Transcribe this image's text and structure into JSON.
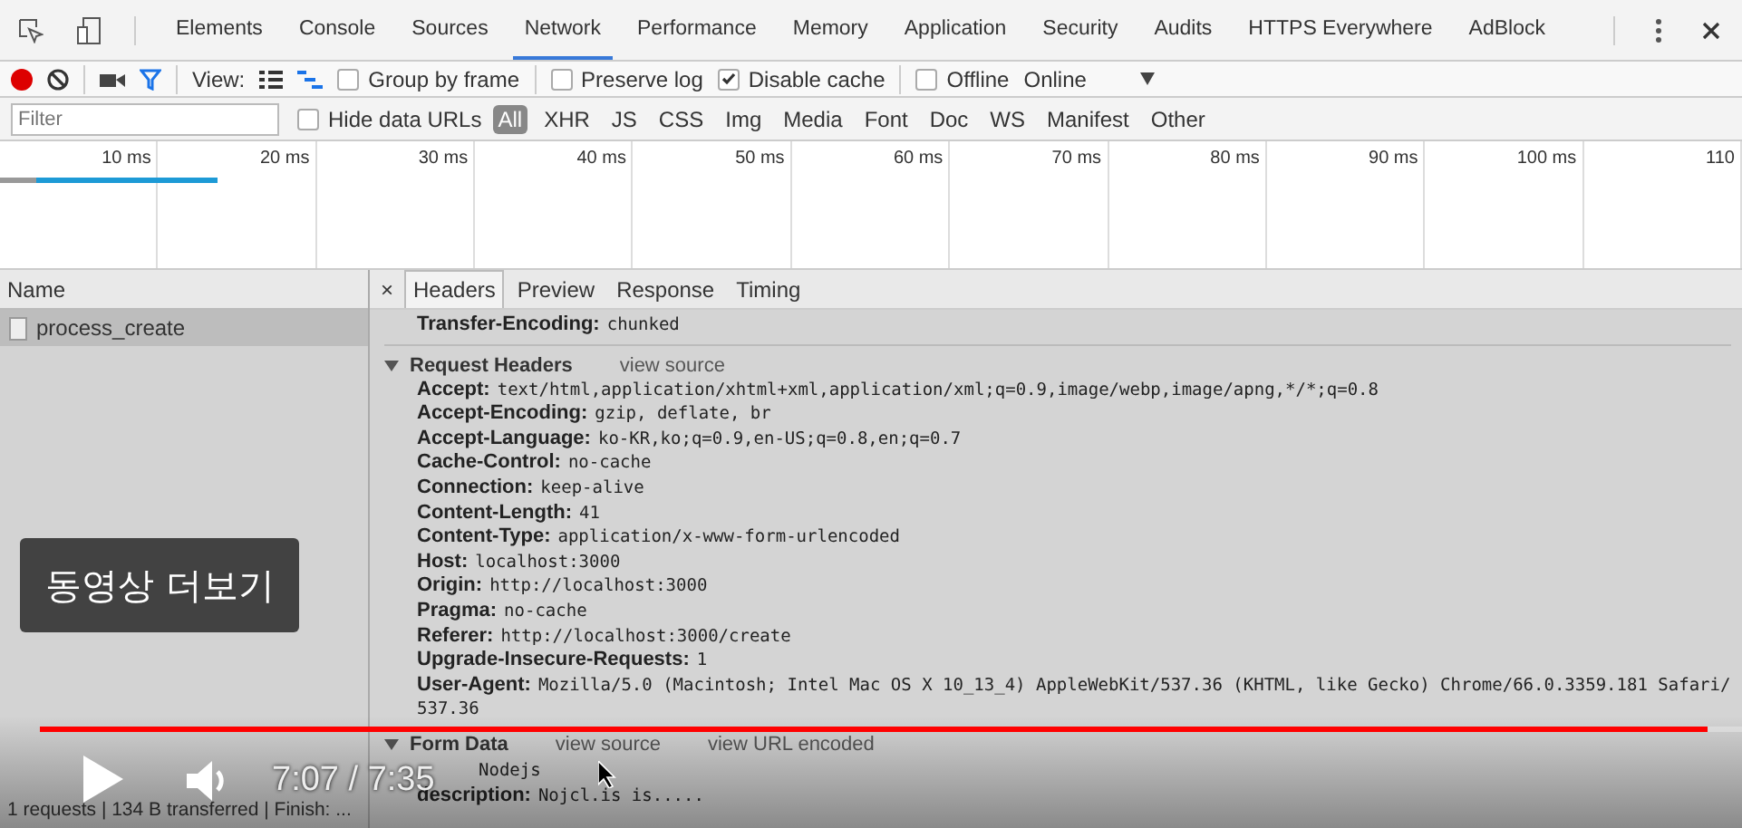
{
  "panel_tabs": [
    {
      "label": "Elements",
      "selected": false
    },
    {
      "label": "Console",
      "selected": false
    },
    {
      "label": "Sources",
      "selected": false
    },
    {
      "label": "Network",
      "selected": true
    },
    {
      "label": "Performance",
      "selected": false
    },
    {
      "label": "Memory",
      "selected": false
    },
    {
      "label": "Application",
      "selected": false
    },
    {
      "label": "Security",
      "selected": false
    },
    {
      "label": "Audits",
      "selected": false
    },
    {
      "label": "HTTPS Everywhere",
      "selected": false
    },
    {
      "label": "AdBlock",
      "selected": false
    }
  ],
  "toolbar": {
    "view_label": "View:",
    "options": [
      {
        "label": "Group by frame",
        "checked": false
      },
      {
        "label": "Preserve log",
        "checked": false
      },
      {
        "label": "Disable cache",
        "checked": true
      },
      {
        "label": "Offline",
        "checked": false
      }
    ],
    "throttling": "Online"
  },
  "filter": {
    "placeholder": "Filter",
    "hide_data_urls": {
      "label": "Hide data URLs",
      "checked": false
    },
    "types": [
      {
        "label": "All",
        "selected": true
      },
      {
        "label": "XHR",
        "selected": false
      },
      {
        "label": "JS",
        "selected": false
      },
      {
        "label": "CSS",
        "selected": false
      },
      {
        "label": "Img",
        "selected": false
      },
      {
        "label": "Media",
        "selected": false
      },
      {
        "label": "Font",
        "selected": false
      },
      {
        "label": "Doc",
        "selected": false
      },
      {
        "label": "WS",
        "selected": false
      },
      {
        "label": "Manifest",
        "selected": false
      },
      {
        "label": "Other",
        "selected": false
      }
    ]
  },
  "timeline": {
    "ticks": [
      "10 ms",
      "20 ms",
      "30 ms",
      "40 ms",
      "50 ms",
      "60 ms",
      "70 ms",
      "80 ms",
      "90 ms",
      "100 ms",
      "110"
    ]
  },
  "requests": {
    "column": "Name",
    "rows": [
      {
        "name": "process_create",
        "selected": true
      }
    ]
  },
  "details": {
    "close": "×",
    "tabs": [
      {
        "label": "Headers",
        "selected": true
      },
      {
        "label": "Preview",
        "selected": false
      },
      {
        "label": "Response",
        "selected": false
      },
      {
        "label": "Timing",
        "selected": false
      }
    ],
    "response_tail": {
      "key": "Transfer-Encoding:",
      "value": "chunked"
    },
    "request_headers": {
      "title": "Request Headers",
      "expanded": true,
      "link": "view source",
      "rows": [
        {
          "key": "Accept:",
          "value": "text/html,application/xhtml+xml,application/xml;q=0.9,image/webp,image/apng,*/*;q=0.8"
        },
        {
          "key": "Accept-Encoding:",
          "value": "gzip, deflate, br"
        },
        {
          "key": "Accept-Language:",
          "value": "ko-KR,ko;q=0.9,en-US;q=0.8,en;q=0.7"
        },
        {
          "key": "Cache-Control:",
          "value": "no-cache"
        },
        {
          "key": "Connection:",
          "value": "keep-alive"
        },
        {
          "key": "Content-Length:",
          "value": "41"
        },
        {
          "key": "Content-Type:",
          "value": "application/x-www-form-urlencoded"
        },
        {
          "key": "Host:",
          "value": "localhost:3000"
        },
        {
          "key": "Origin:",
          "value": "http://localhost:3000"
        },
        {
          "key": "Pragma:",
          "value": "no-cache"
        },
        {
          "key": "Referer:",
          "value": "http://localhost:3000/create"
        },
        {
          "key": "Upgrade-Insecure-Requests:",
          "value": "1"
        },
        {
          "key": "User-Agent:",
          "value": "Mozilla/5.0 (Macintosh; Intel Mac OS X 10_13_4) AppleWebKit/537.36 (KHTML, like Gecko) Chrome/66.0.3359.181 Safari/537.36"
        }
      ]
    },
    "form_data": {
      "title": "Form Data",
      "expanded": true,
      "links": [
        "view source",
        "view URL encoded"
      ],
      "rows": [
        {
          "value": "Nodejs"
        },
        {
          "key": "description:",
          "value": "Nojcl.is is....."
        }
      ]
    }
  },
  "status_bar": "1 requests | 134 B transferred | Finish: ...",
  "video_overlay": {
    "more_videos": "동영상 더보기",
    "time": "7:07 / 7:35",
    "level": 0.98
  }
}
